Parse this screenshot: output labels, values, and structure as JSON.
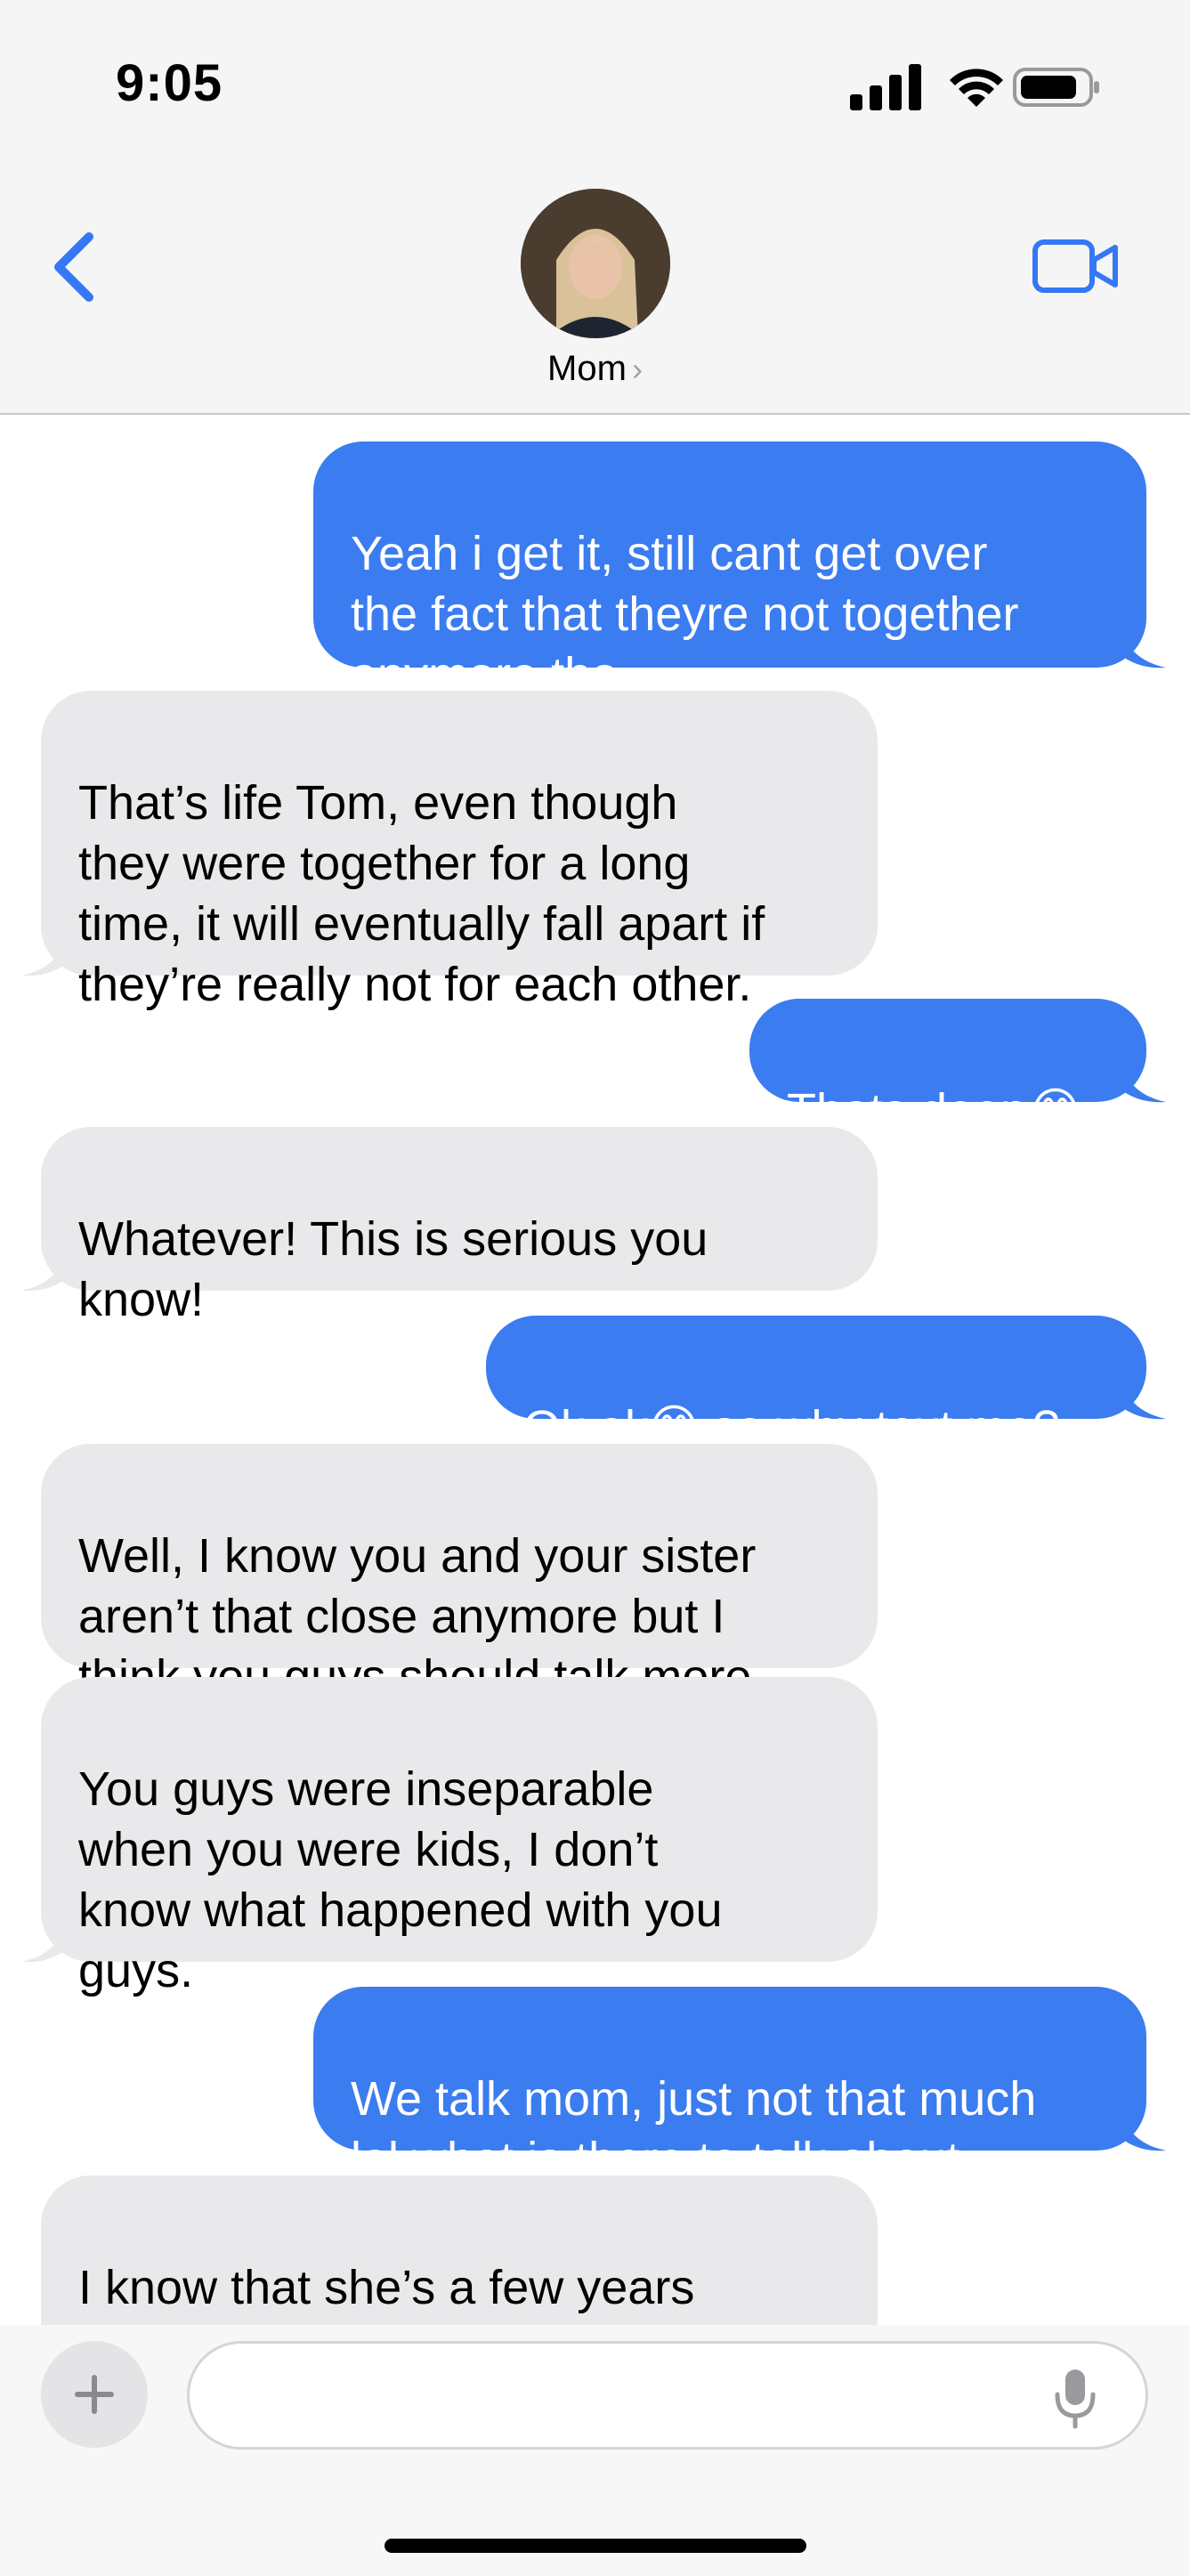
{
  "status_bar": {
    "time": "9:05",
    "icons": [
      "signal-icon",
      "wifi-icon",
      "battery-icon"
    ]
  },
  "header": {
    "contact_name": "Mom",
    "chevron": "›",
    "back_icon": "chevron-left-icon",
    "video_icon": "video-camera-icon"
  },
  "colors": {
    "sent_bubble": "#3b7cf0",
    "received_bubble": "#e9e9eb",
    "accent": "#3478f6"
  },
  "messages": [
    {
      "from": "me",
      "text": "Yeah i get it, still cant get over\nthe fact that theyre not together\nanymore tho"
    },
    {
      "from": "mom",
      "text": "That’s life Tom, even though\nthey were together for a long\ntime, it will eventually fall apart if\nthey’re really not for each other."
    },
    {
      "from": "me",
      "text": "Thats deep😂"
    },
    {
      "from": "mom",
      "text": "Whatever! This is serious you\nknow!"
    },
    {
      "from": "me",
      "text": "Ok ok😅 so why text me?"
    },
    {
      "from": "mom",
      "text": "Well, I know you and your sister\naren’t that close anymore but I\nthink you guys should talk more."
    },
    {
      "from": "mom",
      "text": "You guys were inseparable\nwhen you were kids, I don’t\nknow what happened with you\nguys."
    },
    {
      "from": "me",
      "text": "We talk mom, just not that much\nlol what is there to talk about"
    },
    {
      "from": "mom",
      "text": "I know that she’s a few years\nolder than you but I’m sure you"
    }
  ],
  "compose": {
    "plus_icon": "plus-icon",
    "input_value": "",
    "mic_icon": "microphone-icon"
  }
}
